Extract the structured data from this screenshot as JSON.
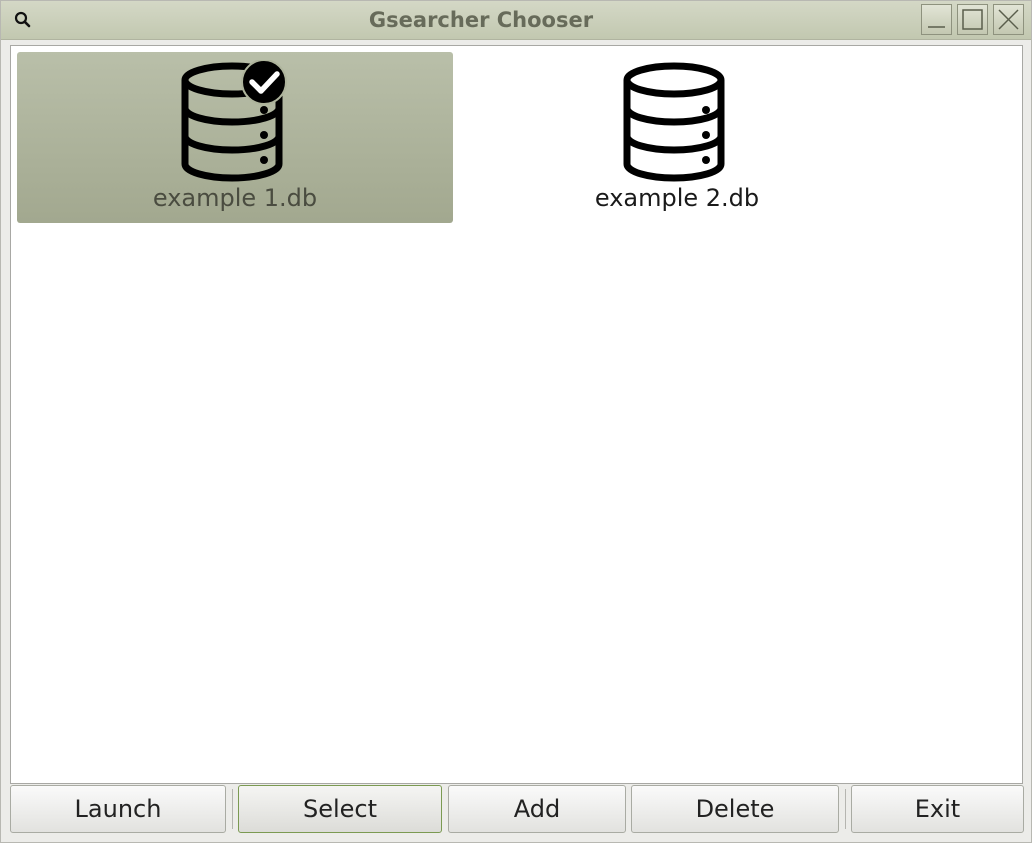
{
  "window": {
    "title": "Gsearcher Chooser",
    "app_icon": "search-icon",
    "controls": [
      "minimize-icon",
      "maximize-icon",
      "close-icon"
    ]
  },
  "databases": [
    {
      "label": "example 1.db",
      "icon": "database-check-icon",
      "selected": true
    },
    {
      "label": "example 2.db",
      "icon": "database-icon",
      "selected": false
    }
  ],
  "buttons": {
    "launch": "Launch",
    "select": "Select",
    "add": "Add",
    "delete": "Delete",
    "exit": "Exit"
  },
  "colors": {
    "titlebar": "#c8ccb8",
    "selection": "#aeb49c",
    "focus_border": "#7b9a52"
  }
}
